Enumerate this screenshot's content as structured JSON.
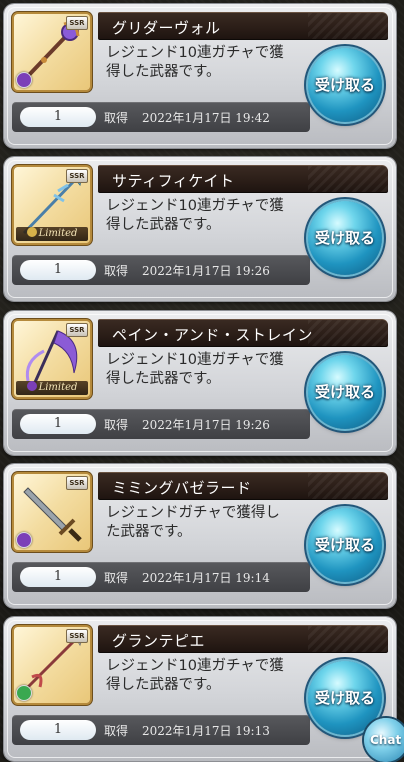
{
  "items": [
    {
      "name": "グリダーヴォル",
      "description_line1": "レジェンド10連ガチャで獲",
      "description_line2": "得した武器です。",
      "quantity": "1",
      "obtained_label": "取得",
      "obtained_date": "2022年1月17日 19:42",
      "receive_label": "受け取る",
      "rarity": "SSR",
      "element": "dark",
      "limited": ""
    },
    {
      "name": "サティフィケイト",
      "description_line1": "レジェンド10連ガチャで獲",
      "description_line2": "得した武器です。",
      "quantity": "1",
      "obtained_label": "取得",
      "obtained_date": "2022年1月17日 19:26",
      "receive_label": "受け取る",
      "rarity": "SSR",
      "element": "light",
      "limited": "Limited"
    },
    {
      "name": "ペイン・アンド・ストレイン",
      "description_line1": "レジェンド10連ガチャで獲",
      "description_line2": "得した武器です。",
      "quantity": "1",
      "obtained_label": "取得",
      "obtained_date": "2022年1月17日 19:26",
      "receive_label": "受け取る",
      "rarity": "SSR",
      "element": "dark",
      "limited": "Limited"
    },
    {
      "name": "ミミングバゼラード",
      "description_line1": "レジェンドガチャで獲得し",
      "description_line2": "た武器です。",
      "quantity": "1",
      "obtained_label": "取得",
      "obtained_date": "2022年1月17日 19:14",
      "receive_label": "受け取る",
      "rarity": "SSR",
      "element": "dark",
      "limited": ""
    },
    {
      "name": "グランテピエ",
      "description_line1": "レジェンド10連ガチャで獲",
      "description_line2": "得した武器です。",
      "quantity": "1",
      "obtained_label": "取得",
      "obtained_date": "2022年1月17日 19:13",
      "receive_label": "受け取る",
      "rarity": "SSR",
      "element": "wind",
      "limited": ""
    }
  ],
  "chat_button": "Chat",
  "colors": {
    "dark": "#7b3fb8",
    "light": "#e0b93a",
    "wind": "#3aa850",
    "receive_button": "#1f94c0"
  }
}
